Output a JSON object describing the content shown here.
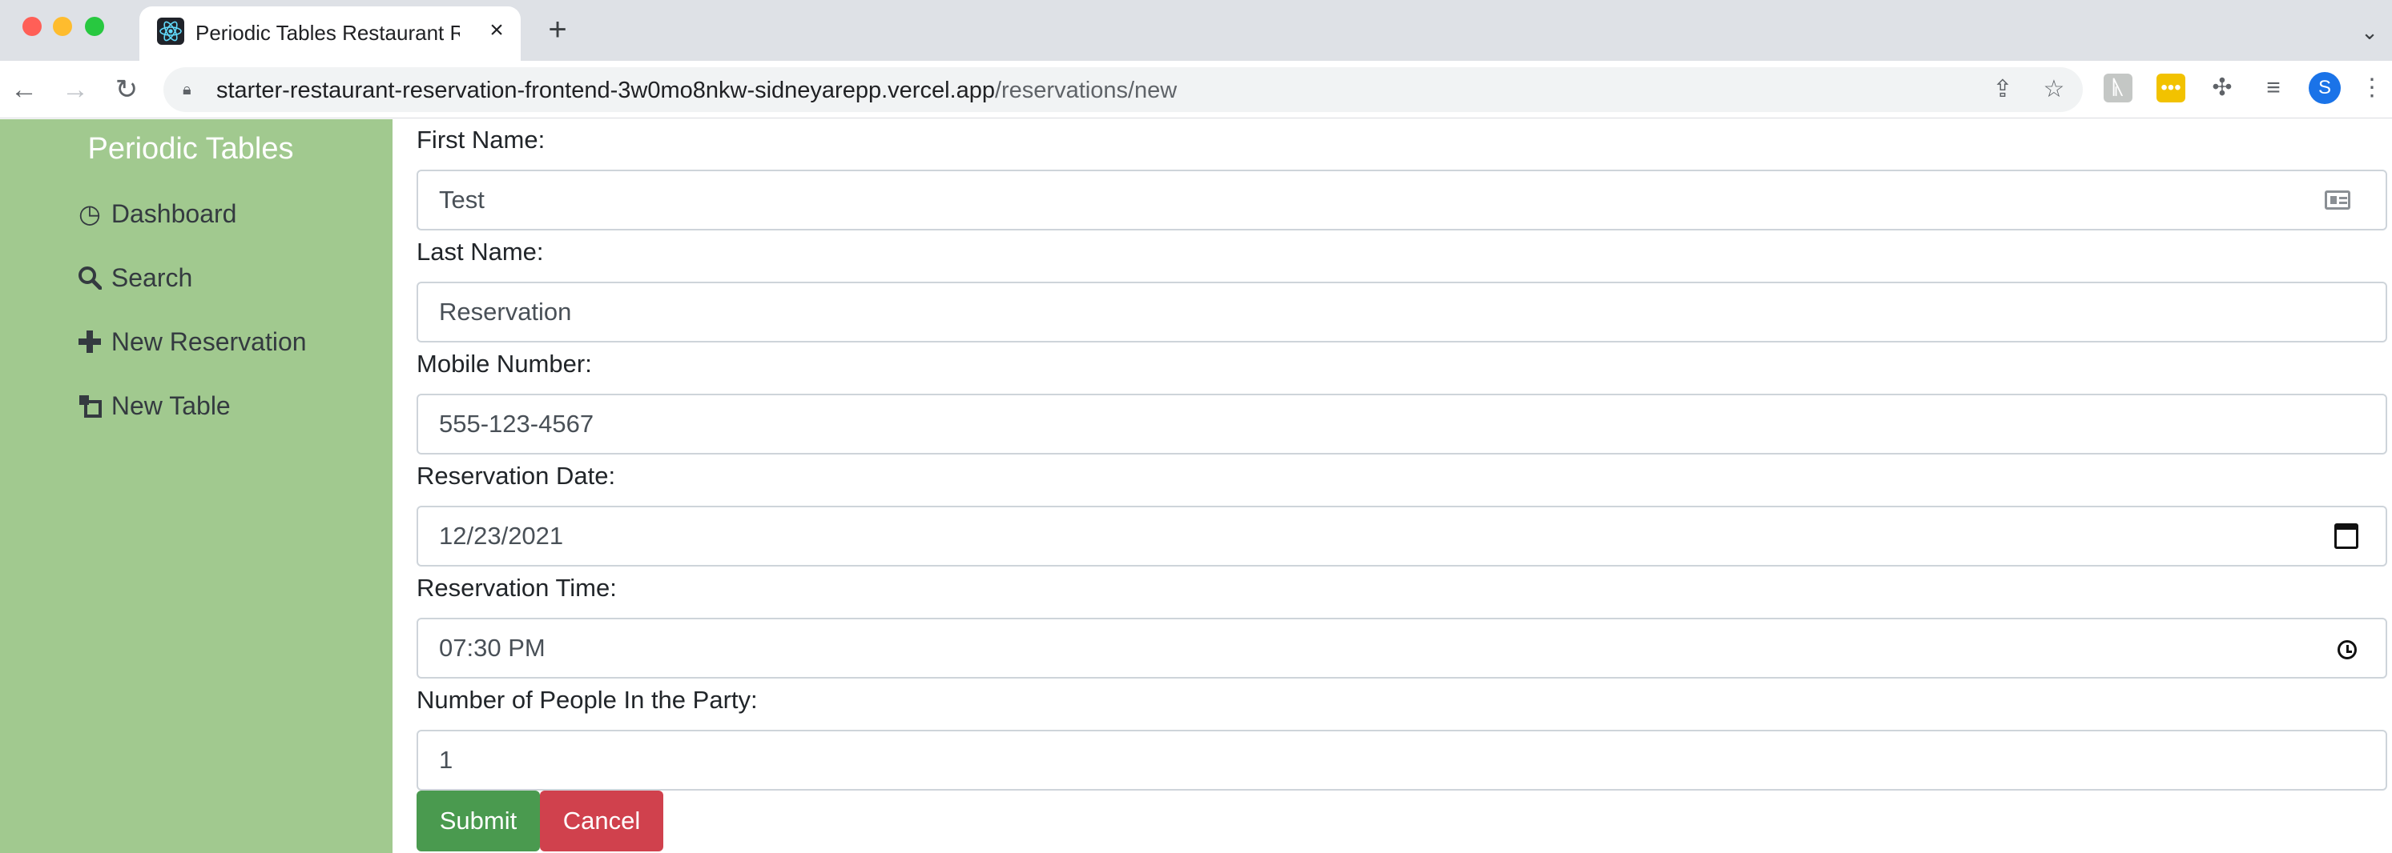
{
  "browser": {
    "tab_title": "Periodic Tables Restaurant Reservation",
    "new_tab_symbol": "+",
    "url_host": "starter-restaurant-reservation-frontend-3w0mo8nkw-sidneyarepp.vercel.app",
    "url_path": "/reservations/new",
    "avatar_letter": "S",
    "icons": [
      "back-icon",
      "forward-icon",
      "reload-icon",
      "lock-icon",
      "share-icon",
      "star-icon",
      "extension-icon",
      "puzzle-icon",
      "media-icon",
      "menu-icon"
    ]
  },
  "sidebar": {
    "brand": "Periodic Tables",
    "items": [
      {
        "label": "Dashboard",
        "icon": "dashboard-icon"
      },
      {
        "label": "Search",
        "icon": "search-icon"
      },
      {
        "label": "New Reservation",
        "icon": "plus-icon"
      },
      {
        "label": "New Table",
        "icon": "table-icon"
      }
    ],
    "background": "#a1c98f"
  },
  "form": {
    "first_name": {
      "label": "First Name:",
      "value": "Test"
    },
    "last_name": {
      "label": "Last Name:",
      "value": "Reservation"
    },
    "mobile_number": {
      "label": "Mobile Number:",
      "value": "555-123-4567"
    },
    "reservation_date": {
      "label": "Reservation Date:",
      "value": "12/23/2021"
    },
    "reservation_time": {
      "label": "Reservation Time:",
      "value": "07:30 PM"
    },
    "people": {
      "label": "Number of People In the Party:",
      "value": "1"
    }
  },
  "buttons": {
    "submit": "Submit",
    "cancel": "Cancel",
    "submit_color": "#4a9a4f",
    "cancel_color": "#d0414d"
  }
}
